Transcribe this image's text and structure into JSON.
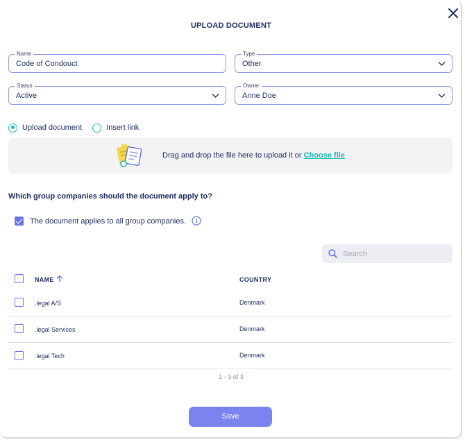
{
  "modal": {
    "title": "UPLOAD DOCUMENT"
  },
  "fields": {
    "name": {
      "label": "Name",
      "value": "Code of Condouct"
    },
    "type": {
      "label": "Type",
      "value": "Other"
    },
    "status": {
      "label": "Status",
      "value": "Active"
    },
    "owner": {
      "label": "Owner",
      "value": "Anne Doe"
    }
  },
  "source": {
    "options": [
      {
        "label": "Upload document",
        "selected": true
      },
      {
        "label": "Insert link",
        "selected": false
      }
    ]
  },
  "dropzone": {
    "text": "Drag and drop the file here to upload it or",
    "link": "Choose file"
  },
  "companies": {
    "question": "Which group companies should the document apply to?",
    "applies_all_label": "The document applies to all group companies.",
    "applies_all_checked": true
  },
  "search": {
    "placeholder": "Search"
  },
  "table": {
    "columns": {
      "name": "NAME",
      "country": "COUNTRY"
    },
    "rows": [
      {
        "name": ".legal A/S",
        "country": "Denmark"
      },
      {
        "name": ".legal Services",
        "country": "Denmark"
      },
      {
        "name": ".legal Tech",
        "country": "Denmark"
      }
    ],
    "pagination": "1 - 3 of 3"
  },
  "actions": {
    "save": "Save"
  },
  "colors": {
    "accent": "#6a74e0",
    "teal": "#1bb8b2",
    "button": "#7b83ef",
    "text": "#1d2a5c"
  },
  "icons": [
    "close-icon",
    "chevron-down-icon",
    "document-upload-icon",
    "info-icon",
    "search-icon",
    "sort-arrow-up-icon"
  ]
}
